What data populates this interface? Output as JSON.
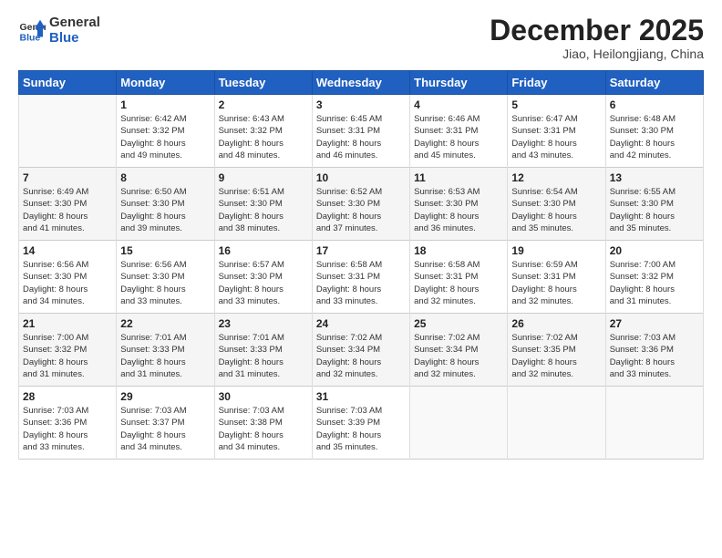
{
  "header": {
    "logo_general": "General",
    "logo_blue": "Blue",
    "month_title": "December 2025",
    "location": "Jiao, Heilongjiang, China"
  },
  "weekdays": [
    "Sunday",
    "Monday",
    "Tuesday",
    "Wednesday",
    "Thursday",
    "Friday",
    "Saturday"
  ],
  "weeks": [
    [
      {
        "day": "",
        "info": ""
      },
      {
        "day": "1",
        "info": "Sunrise: 6:42 AM\nSunset: 3:32 PM\nDaylight: 8 hours\nand 49 minutes."
      },
      {
        "day": "2",
        "info": "Sunrise: 6:43 AM\nSunset: 3:32 PM\nDaylight: 8 hours\nand 48 minutes."
      },
      {
        "day": "3",
        "info": "Sunrise: 6:45 AM\nSunset: 3:31 PM\nDaylight: 8 hours\nand 46 minutes."
      },
      {
        "day": "4",
        "info": "Sunrise: 6:46 AM\nSunset: 3:31 PM\nDaylight: 8 hours\nand 45 minutes."
      },
      {
        "day": "5",
        "info": "Sunrise: 6:47 AM\nSunset: 3:31 PM\nDaylight: 8 hours\nand 43 minutes."
      },
      {
        "day": "6",
        "info": "Sunrise: 6:48 AM\nSunset: 3:30 PM\nDaylight: 8 hours\nand 42 minutes."
      }
    ],
    [
      {
        "day": "7",
        "info": "Sunrise: 6:49 AM\nSunset: 3:30 PM\nDaylight: 8 hours\nand 41 minutes."
      },
      {
        "day": "8",
        "info": "Sunrise: 6:50 AM\nSunset: 3:30 PM\nDaylight: 8 hours\nand 39 minutes."
      },
      {
        "day": "9",
        "info": "Sunrise: 6:51 AM\nSunset: 3:30 PM\nDaylight: 8 hours\nand 38 minutes."
      },
      {
        "day": "10",
        "info": "Sunrise: 6:52 AM\nSunset: 3:30 PM\nDaylight: 8 hours\nand 37 minutes."
      },
      {
        "day": "11",
        "info": "Sunrise: 6:53 AM\nSunset: 3:30 PM\nDaylight: 8 hours\nand 36 minutes."
      },
      {
        "day": "12",
        "info": "Sunrise: 6:54 AM\nSunset: 3:30 PM\nDaylight: 8 hours\nand 35 minutes."
      },
      {
        "day": "13",
        "info": "Sunrise: 6:55 AM\nSunset: 3:30 PM\nDaylight: 8 hours\nand 35 minutes."
      }
    ],
    [
      {
        "day": "14",
        "info": "Sunrise: 6:56 AM\nSunset: 3:30 PM\nDaylight: 8 hours\nand 34 minutes."
      },
      {
        "day": "15",
        "info": "Sunrise: 6:56 AM\nSunset: 3:30 PM\nDaylight: 8 hours\nand 33 minutes."
      },
      {
        "day": "16",
        "info": "Sunrise: 6:57 AM\nSunset: 3:30 PM\nDaylight: 8 hours\nand 33 minutes."
      },
      {
        "day": "17",
        "info": "Sunrise: 6:58 AM\nSunset: 3:31 PM\nDaylight: 8 hours\nand 33 minutes."
      },
      {
        "day": "18",
        "info": "Sunrise: 6:58 AM\nSunset: 3:31 PM\nDaylight: 8 hours\nand 32 minutes."
      },
      {
        "day": "19",
        "info": "Sunrise: 6:59 AM\nSunset: 3:31 PM\nDaylight: 8 hours\nand 32 minutes."
      },
      {
        "day": "20",
        "info": "Sunrise: 7:00 AM\nSunset: 3:32 PM\nDaylight: 8 hours\nand 31 minutes."
      }
    ],
    [
      {
        "day": "21",
        "info": "Sunrise: 7:00 AM\nSunset: 3:32 PM\nDaylight: 8 hours\nand 31 minutes."
      },
      {
        "day": "22",
        "info": "Sunrise: 7:01 AM\nSunset: 3:33 PM\nDaylight: 8 hours\nand 31 minutes."
      },
      {
        "day": "23",
        "info": "Sunrise: 7:01 AM\nSunset: 3:33 PM\nDaylight: 8 hours\nand 31 minutes."
      },
      {
        "day": "24",
        "info": "Sunrise: 7:02 AM\nSunset: 3:34 PM\nDaylight: 8 hours\nand 32 minutes."
      },
      {
        "day": "25",
        "info": "Sunrise: 7:02 AM\nSunset: 3:34 PM\nDaylight: 8 hours\nand 32 minutes."
      },
      {
        "day": "26",
        "info": "Sunrise: 7:02 AM\nSunset: 3:35 PM\nDaylight: 8 hours\nand 32 minutes."
      },
      {
        "day": "27",
        "info": "Sunrise: 7:03 AM\nSunset: 3:36 PM\nDaylight: 8 hours\nand 33 minutes."
      }
    ],
    [
      {
        "day": "28",
        "info": "Sunrise: 7:03 AM\nSunset: 3:36 PM\nDaylight: 8 hours\nand 33 minutes."
      },
      {
        "day": "29",
        "info": "Sunrise: 7:03 AM\nSunset: 3:37 PM\nDaylight: 8 hours\nand 34 minutes."
      },
      {
        "day": "30",
        "info": "Sunrise: 7:03 AM\nSunset: 3:38 PM\nDaylight: 8 hours\nand 34 minutes."
      },
      {
        "day": "31",
        "info": "Sunrise: 7:03 AM\nSunset: 3:39 PM\nDaylight: 8 hours\nand 35 minutes."
      },
      {
        "day": "",
        "info": ""
      },
      {
        "day": "",
        "info": ""
      },
      {
        "day": "",
        "info": ""
      }
    ]
  ]
}
